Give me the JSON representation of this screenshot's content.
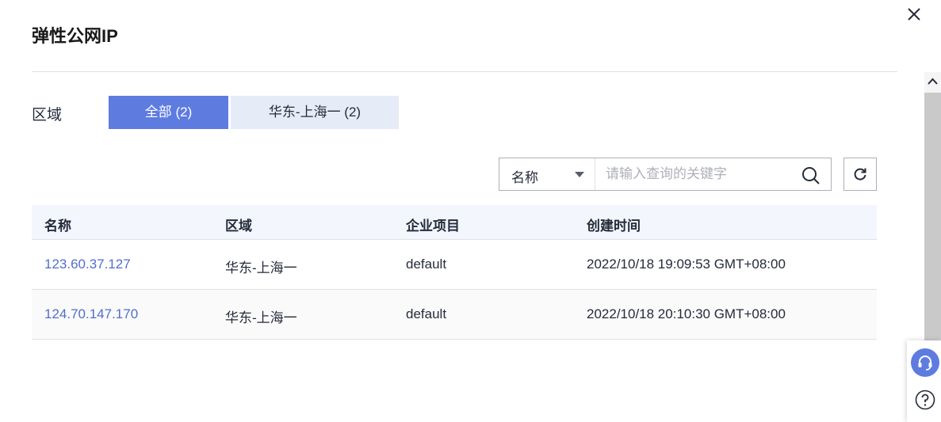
{
  "dialog": {
    "title": "弹性公网IP"
  },
  "region": {
    "label": "区域",
    "tabs": [
      {
        "label": "全部 (2)",
        "active": true
      },
      {
        "label": "华东-上海一 (2)",
        "active": false
      }
    ]
  },
  "search": {
    "field_selected": "名称",
    "placeholder": "请输入查询的关键字",
    "value": ""
  },
  "table": {
    "columns": [
      "名称",
      "区域",
      "企业项目",
      "创建时间"
    ],
    "rows": [
      [
        "123.60.37.127",
        "华东-上海一",
        "default",
        "2022/10/18 19:09:53 GMT+08:00"
      ],
      [
        "124.70.147.170",
        "华东-上海一",
        "default",
        "2022/10/18 20:10:30 GMT+08:00"
      ]
    ]
  },
  "icons": {
    "close": "close-icon",
    "search": "search-icon",
    "refresh": "refresh-icon",
    "dropdown": "caret-down-icon",
    "scroll_up": "chevron-up-icon",
    "customer_service": "headset-icon",
    "help": "question-circle-icon"
  },
  "colors": {
    "accent": "#5e7ce0",
    "accent_light": "#e6ebf8",
    "link": "#526ecc",
    "header_bg": "#f3f6fd"
  }
}
